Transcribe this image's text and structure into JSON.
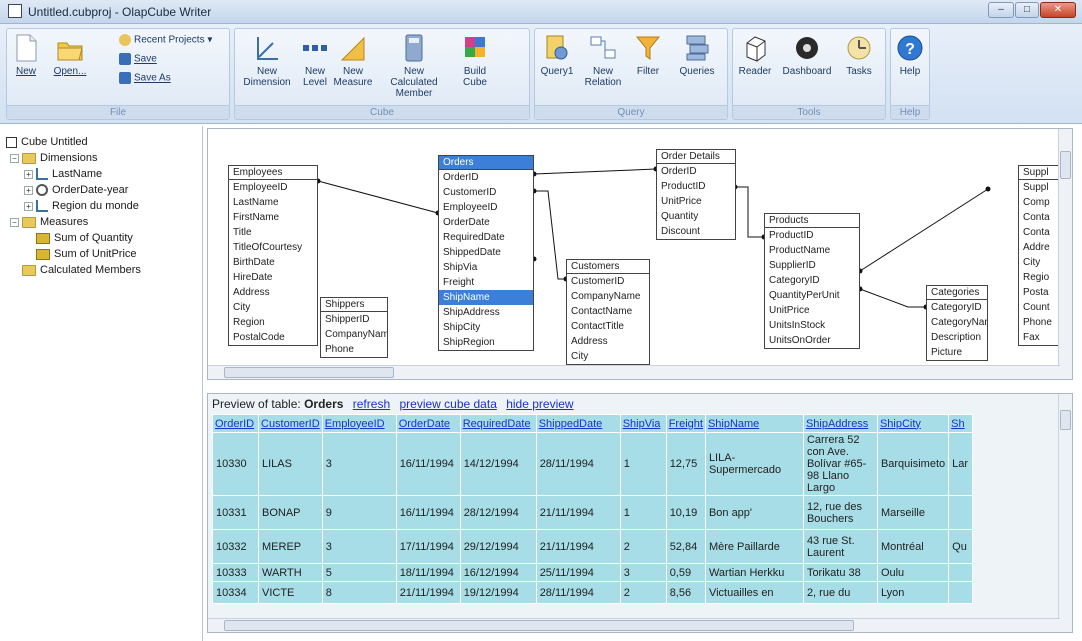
{
  "window": {
    "title": "Untitled.cubproj - OlapCube Writer",
    "min": "–",
    "max": "□",
    "close": "✕"
  },
  "ribbon": {
    "file": {
      "label": "File",
      "new": "New",
      "open": "Open...",
      "recent": "Recent Projects ▾",
      "save": "Save",
      "save_as": "Save As"
    },
    "cube": {
      "label": "Cube",
      "new_dimension": "New Dimension",
      "new_level": "New Level",
      "new_measure": "New Measure",
      "new_calc": "New Calculated Member",
      "build": "Build Cube"
    },
    "query": {
      "label": "Query",
      "query1": "Query1",
      "new_relation": "New Relation",
      "filter": "Filter",
      "queries": "Queries"
    },
    "tools": {
      "label": "Tools",
      "reader": "Reader",
      "dashboard": "Dashboard",
      "tasks": "Tasks"
    },
    "help": {
      "label": "Help",
      "help": "Help"
    }
  },
  "tree": {
    "root": "Cube Untitled",
    "dimensions": "Dimensions",
    "dim1": "LastName",
    "dim2": "OrderDate-year",
    "dim3": "Region du monde",
    "measures": "Measures",
    "m1": "Sum of Quantity",
    "m2": "Sum of UnitPrice",
    "calculated": "Calculated Members"
  },
  "diagram": {
    "employees": {
      "title": "Employees",
      "fields": [
        "EmployeeID",
        "LastName",
        "FirstName",
        "Title",
        "TitleOfCourtesy",
        "BirthDate",
        "HireDate",
        "Address",
        "City",
        "Region",
        "PostalCode"
      ]
    },
    "orders": {
      "title": "Orders",
      "fields": [
        "OrderID",
        "CustomerID",
        "EmployeeID",
        "OrderDate",
        "RequiredDate",
        "ShippedDate",
        "ShipVia",
        "Freight",
        "ShipName",
        "ShipAddress",
        "ShipCity",
        "ShipRegion"
      ]
    },
    "order_details": {
      "title": "Order Details",
      "fields": [
        "OrderID",
        "ProductID",
        "UnitPrice",
        "Quantity",
        "Discount"
      ]
    },
    "shippers": {
      "title": "Shippers",
      "fields": [
        "ShipperID",
        "CompanyName",
        "Phone"
      ]
    },
    "customers": {
      "title": "Customers",
      "fields": [
        "CustomerID",
        "CompanyName",
        "ContactName",
        "ContactTitle",
        "Address",
        "City"
      ]
    },
    "products": {
      "title": "Products",
      "fields": [
        "ProductID",
        "ProductName",
        "SupplierID",
        "CategoryID",
        "QuantityPerUnit",
        "UnitPrice",
        "UnitsInStock",
        "UnitsOnOrder"
      ]
    },
    "categories": {
      "title": "Categories",
      "fields": [
        "CategoryID",
        "CategoryName",
        "Description",
        "Picture"
      ]
    },
    "suppliers": {
      "title": "Suppl",
      "fields": [
        "Suppl",
        "Comp",
        "Conta",
        "Conta",
        "Addre",
        "City",
        "Regio",
        "Posta",
        "Count",
        "Phone",
        "Fax"
      ]
    }
  },
  "preview": {
    "label": "Preview of table:",
    "table": "Orders",
    "refresh": "refresh",
    "preview_cube": "preview cube data",
    "hide": "hide preview",
    "columns": [
      "OrderID",
      "CustomerID",
      "EmployeeID",
      "OrderDate",
      "RequiredDate",
      "ShippedDate",
      "ShipVia",
      "Freight",
      "ShipName",
      "ShipAddress",
      "ShipCity",
      "Sh"
    ],
    "rows": [
      [
        "10330",
        "LILAS",
        "3",
        "16/11/1994",
        "14/12/1994",
        "28/11/1994",
        "1",
        "12,75",
        "LILA-Supermercado",
        "Carrera 52 con Ave. Bolívar #65-98 Llano Largo",
        "Barquisimeto",
        "Lar"
      ],
      [
        "10331",
        "BONAP",
        "9",
        "16/11/1994",
        "28/12/1994",
        "21/11/1994",
        "1",
        "10,19",
        "Bon app'",
        "12, rue des Bouchers",
        "Marseille",
        ""
      ],
      [
        "10332",
        "MEREP",
        "3",
        "17/11/1994",
        "29/12/1994",
        "21/11/1994",
        "2",
        "52,84",
        "Mère Paillarde",
        "43 rue St. Laurent",
        "Montréal",
        "Qu"
      ],
      [
        "10333",
        "WARTH",
        "5",
        "18/11/1994",
        "16/12/1994",
        "25/11/1994",
        "3",
        "0,59",
        "Wartian Herkku",
        "Torikatu 38",
        "Oulu",
        ""
      ],
      [
        "10334",
        "VICTE",
        "8",
        "21/11/1994",
        "19/12/1994",
        "28/11/1994",
        "2",
        "8,56",
        "Victuailles en",
        "2, rue du",
        "Lyon",
        ""
      ]
    ]
  }
}
